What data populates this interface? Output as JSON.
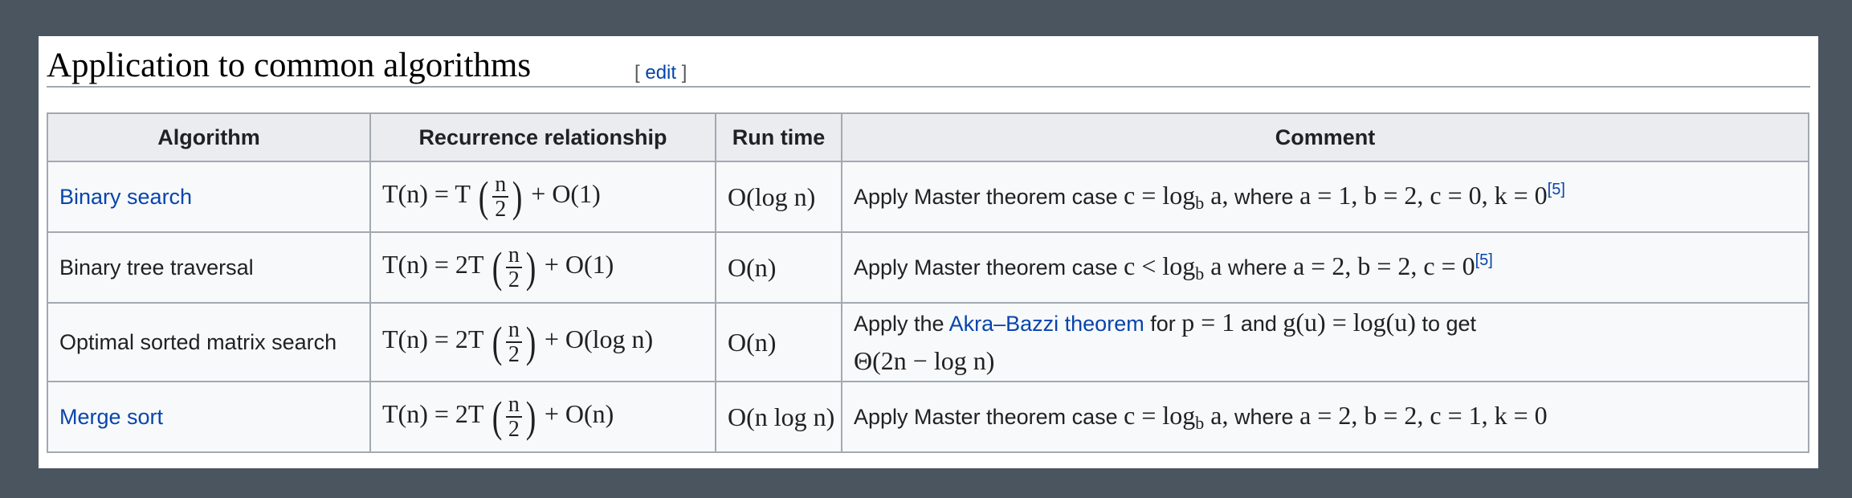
{
  "section": {
    "heading": "Application to common algorithms",
    "edit_bracket_open": "[",
    "edit_label": "edit",
    "edit_bracket_close": "]"
  },
  "table": {
    "headers": {
      "algorithm": "Algorithm",
      "recurrence": "Recurrence relationship",
      "runtime": "Run time",
      "comment": "Comment"
    },
    "rows": [
      {
        "algorithm": "Binary search",
        "recurrence_lhs": "T(n) = T",
        "recurrence_rhs": "+ O(1)",
        "runtime": "O(log n)",
        "comment_pre": "Apply Master theorem case",
        "comment_math1": "c = log",
        "comment_math1_sub": "b",
        "comment_math1_tail": "a,",
        "comment_mid": "where",
        "comment_math2": "a = 1, b = 2, c = 0, k = 0",
        "ref": "[5]"
      },
      {
        "algorithm": "Binary tree traversal",
        "recurrence_lhs": "T(n) = 2T",
        "recurrence_rhs": "+ O(1)",
        "runtime": "O(n)",
        "comment_pre": "Apply Master theorem case",
        "comment_math1": "c < log",
        "comment_math1_sub": "b",
        "comment_math1_tail": "a",
        "comment_mid": "where",
        "comment_math2": "a = 2, b = 2, c = 0",
        "ref": "[5]"
      },
      {
        "algorithm": "Optimal sorted matrix search",
        "recurrence_lhs": "T(n) = 2T",
        "recurrence_rhs": "+ O(log n)",
        "runtime": "O(n)",
        "comment_pre": "Apply the",
        "comment_link": "Akra–Bazzi theorem",
        "comment_for": "for",
        "comment_p": "p = 1",
        "comment_and": "and",
        "comment_g": "g(u) = log(u)",
        "comment_toget": "to get",
        "comment_result": "Θ(2n − log n)"
      },
      {
        "algorithm": "Merge sort",
        "recurrence_lhs": "T(n) = 2T",
        "recurrence_rhs": "+ O(n)",
        "runtime": "O(n log n)",
        "comment_pre": "Apply Master theorem case",
        "comment_math1": "c = log",
        "comment_math1_sub": "b",
        "comment_math1_tail": "a,",
        "comment_mid": "where",
        "comment_math2": "a = 2, b = 2, c = 1, k = 0"
      }
    ],
    "fraction": {
      "numerator": "n",
      "denominator": "2"
    }
  },
  "colors": {
    "link": "#0645ad",
    "header_bg": "#eaecf0",
    "cell_bg": "#f8f9fa",
    "border": "#a2a9b1"
  }
}
